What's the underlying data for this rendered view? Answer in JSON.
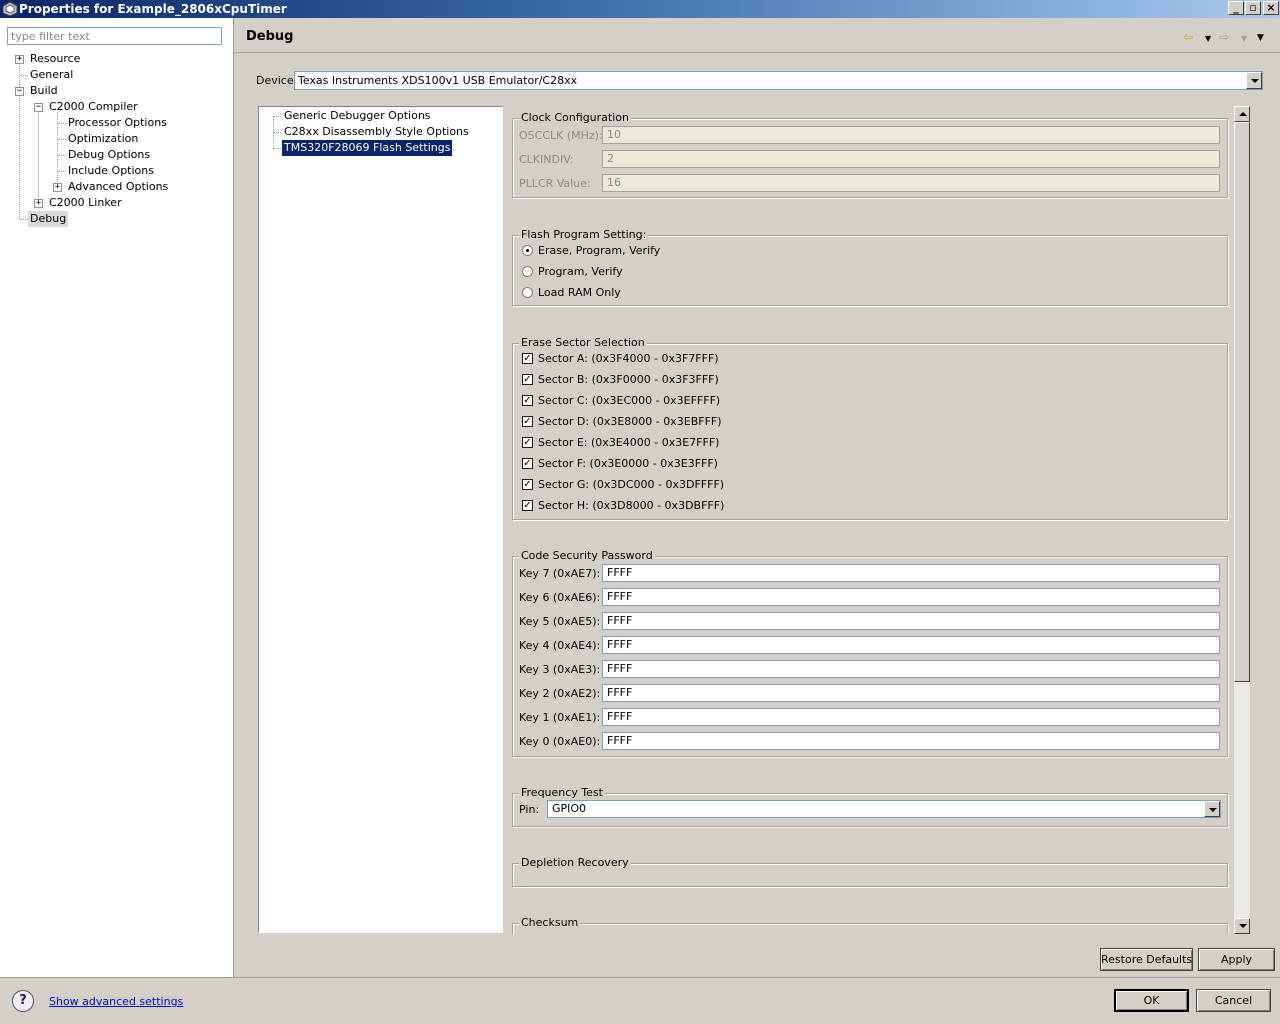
{
  "window": {
    "title": "Properties for Example_2806xCpuTimer",
    "buttons": [
      "minimize",
      "restore",
      "close"
    ]
  },
  "filter": {
    "placeholder": "type filter text"
  },
  "tree": {
    "resource": "Resource",
    "general": "General",
    "build": "Build",
    "c2000_compiler": "C2000 Compiler",
    "processor_options": "Processor Options",
    "optimization": "Optimization",
    "debug_options": "Debug Options",
    "include_options": "Include Options",
    "advanced_options": "Advanced Options",
    "c2000_linker": "C2000 Linker",
    "debug": "Debug",
    "selected": "Debug"
  },
  "header": {
    "title": "Debug"
  },
  "device": {
    "label": "Device",
    "value": "Texas Instruments XDS100v1 USB Emulator/C28xx"
  },
  "categories": {
    "items": [
      "Generic Debugger Options",
      "C28xx Disassembly Style Options",
      "TMS320F28069 Flash Settings"
    ],
    "selected": "TMS320F28069 Flash Settings"
  },
  "clock": {
    "title": "Clock Configuration",
    "oscclk_label": "OSCCLK (MHz):",
    "oscclk_value": "10",
    "clkindiv_label": "CLKINDIV:",
    "clkindiv_value": "2",
    "pllcr_label": "PLLCR Value:",
    "pllcr_value": "16"
  },
  "flash_program": {
    "title": "Flash Program Setting:",
    "options": [
      "Erase, Program, Verify",
      "Program, Verify",
      "Load RAM Only"
    ],
    "selected": "Erase, Program, Verify"
  },
  "erase_sectors": {
    "title": "Erase Sector Selection",
    "items": [
      {
        "label": "Sector A: (0x3F4000 - 0x3F7FFF)",
        "checked": true
      },
      {
        "label": "Sector B: (0x3F0000 - 0x3F3FFF)",
        "checked": true
      },
      {
        "label": "Sector C: (0x3EC000 - 0x3EFFFF)",
        "checked": true
      },
      {
        "label": "Sector D: (0x3E8000 - 0x3EBFFF)",
        "checked": true
      },
      {
        "label": "Sector E: (0x3E4000 - 0x3E7FFF)",
        "checked": true
      },
      {
        "label": "Sector F: (0x3E0000 - 0x3E3FFF)",
        "checked": true
      },
      {
        "label": "Sector G: (0x3DC000 - 0x3DFFFF)",
        "checked": true
      },
      {
        "label": "Sector H: (0x3D8000 - 0x3DBFFF)",
        "checked": true
      }
    ]
  },
  "password": {
    "title": "Code Security Password",
    "keys": [
      {
        "label": "Key 7 (0xAE7):",
        "value": "FFFF"
      },
      {
        "label": "Key 6 (0xAE6):",
        "value": "FFFF"
      },
      {
        "label": "Key 5 (0xAE5):",
        "value": "FFFF"
      },
      {
        "label": "Key 4 (0xAE4):",
        "value": "FFFF"
      },
      {
        "label": "Key 3 (0xAE3):",
        "value": "FFFF"
      },
      {
        "label": "Key 2 (0xAE2):",
        "value": "FFFF"
      },
      {
        "label": "Key 1 (0xAE1):",
        "value": "FFFF"
      },
      {
        "label": "Key 0 (0xAE0):",
        "value": "FFFF"
      }
    ]
  },
  "frequency": {
    "title": "Frequency Test",
    "pin_label": "Pin:",
    "pin_value": "GPIO0"
  },
  "depletion": {
    "title": "Depletion Recovery"
  },
  "checksum": {
    "title": "Checksum"
  },
  "buttons": {
    "restore_defaults": "Restore Defaults",
    "apply": "Apply",
    "ok": "OK",
    "cancel": "Cancel"
  },
  "footer": {
    "advanced_link": "Show advanced settings"
  }
}
